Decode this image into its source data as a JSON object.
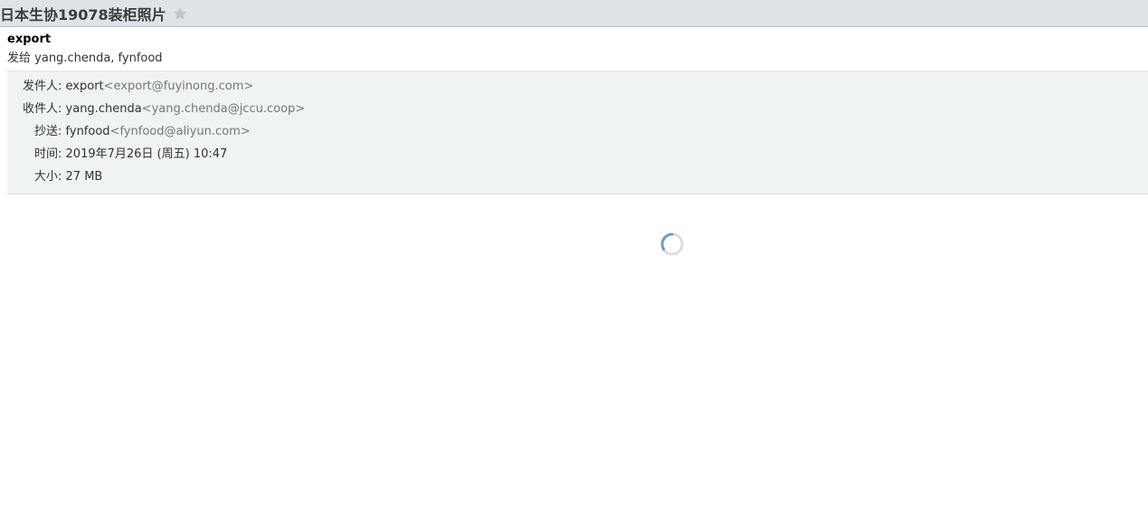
{
  "subject": "日本生协19078装柜照片",
  "star_icon": "star-icon",
  "sender": {
    "name": "export",
    "sent_to_prefix": "发给",
    "sent_to_names": "yang.chenda, fynfood"
  },
  "details": {
    "from": {
      "label": "发件人:",
      "name": "export",
      "email": "<export@fuyinong.com>"
    },
    "to": {
      "label": "收件人:",
      "name": "yang.chenda",
      "email": "<yang.chenda@jccu.coop>"
    },
    "cc": {
      "label": "抄送:",
      "name": "fynfood",
      "email": "<fynfood@aliyun.com>"
    },
    "time": {
      "label": "时间:",
      "value": "2019年7月26日 (周五) 10:47"
    },
    "size": {
      "label": "大小:",
      "value": "27 MB"
    }
  },
  "colors": {
    "subject_bar": "#dfe3e8",
    "details_bg": "#eff3f2",
    "spinner_active": "#6d9cc4",
    "spinner_track": "#dcdcdc"
  },
  "loading_icon": "spinner-icon"
}
